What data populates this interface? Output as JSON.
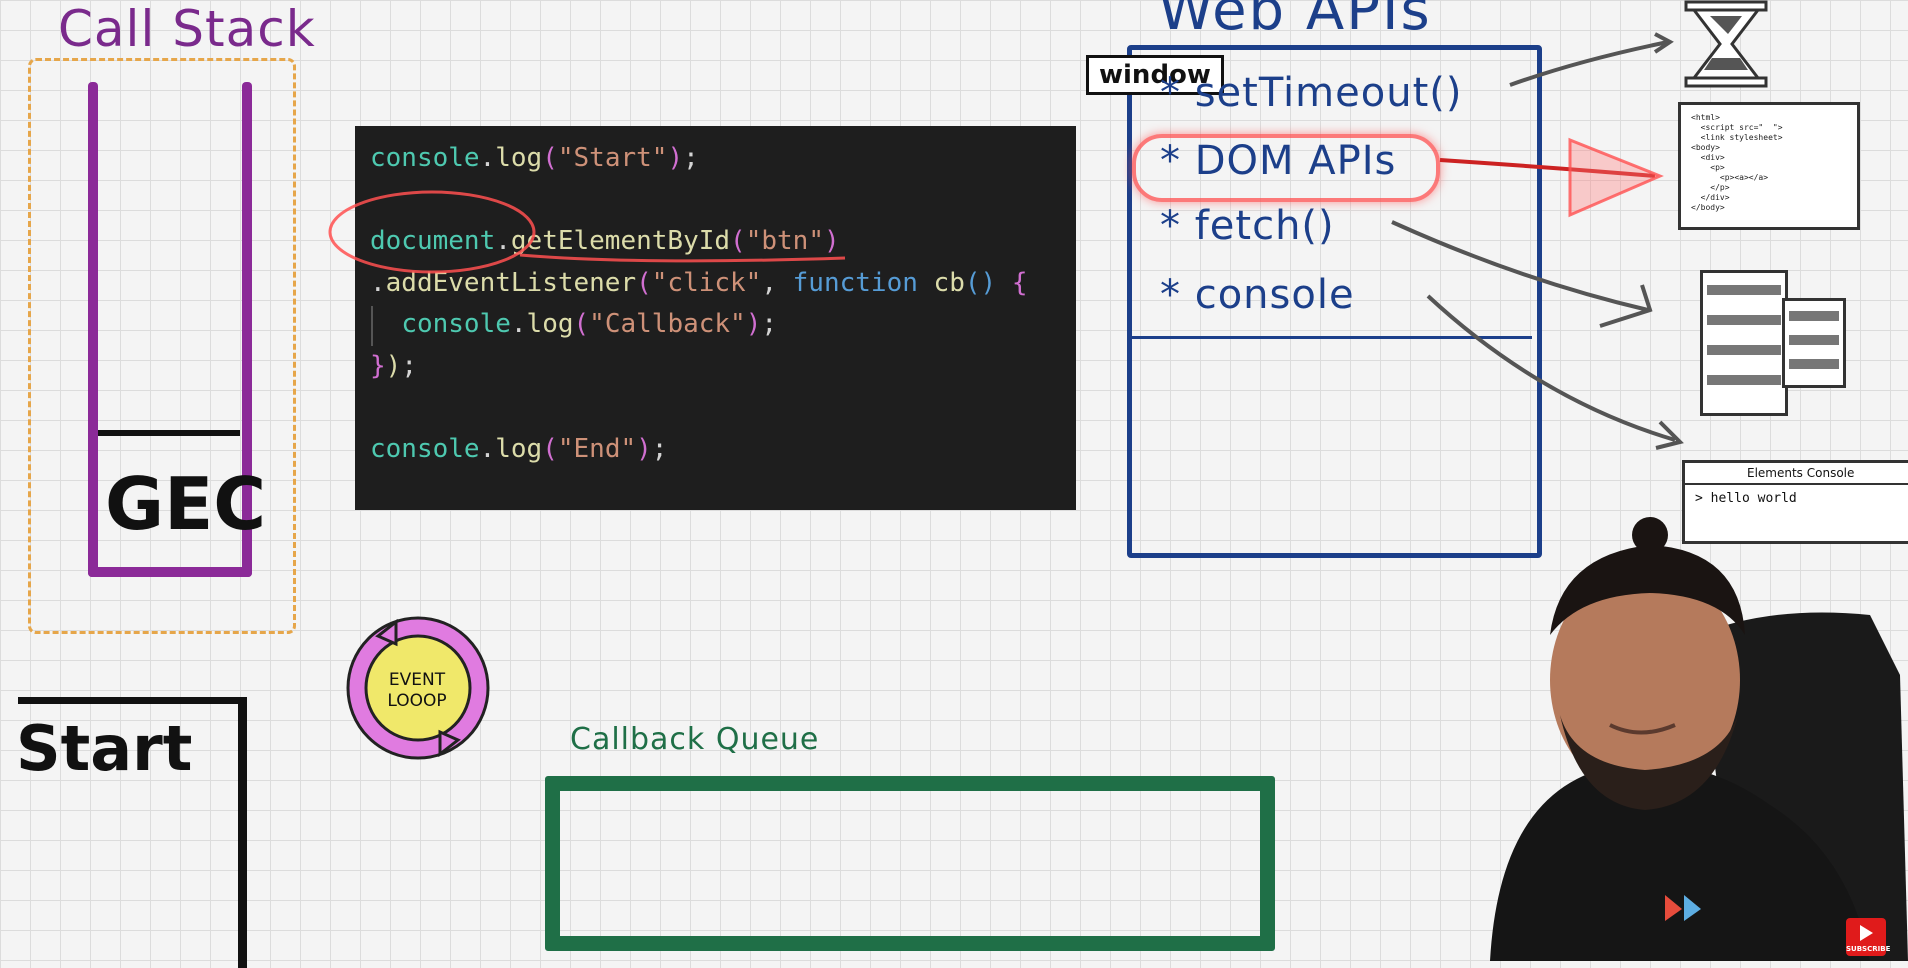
{
  "call_stack": {
    "title": "Call Stack",
    "frame": "GEC"
  },
  "code": {
    "line1": {
      "obj": "console",
      "fn": "log",
      "str": "\"Start\""
    },
    "line2": {
      "obj": "document",
      "fn": "getElementById",
      "str": "\"btn\""
    },
    "line3": {
      "fn": "addEventListener",
      "str": "\"click\"",
      "kw": "function",
      "name": "cb"
    },
    "line4": {
      "obj": "console",
      "fn": "log",
      "str": "\"Callback\""
    },
    "line6": {
      "obj": "console",
      "fn": "log",
      "str": "\"End\""
    }
  },
  "web_apis": {
    "title": "Web APIs",
    "tag": "window",
    "items": [
      "* setTimeout()",
      "* DOM APIs",
      "* fetch()",
      "* console"
    ]
  },
  "devtools": {
    "tabs": "Elements   Console",
    "output": "> hello world"
  },
  "html_doc_lines": "<html>\n  <script src=\"  \">\n  <link stylesheet>\n<body>\n  <div>\n    <p>\n      <p><a></a>\n    </p>\n  </div>\n</body>",
  "start": {
    "label": "Start"
  },
  "event_loop": {
    "line1": "EVENT",
    "line2": "LOOOP"
  },
  "callback_queue": {
    "title": "Callback Queue"
  },
  "youtube": {
    "label": "SUBSCRIBE"
  },
  "colors": {
    "call_stack": "#8b2a98",
    "web_apis": "#1c3f8a",
    "callback_queue": "#1f6f47",
    "highlight": "#ff5050",
    "event_loop_ring": "#e07be0",
    "event_loop_center": "#f0e86a"
  }
}
